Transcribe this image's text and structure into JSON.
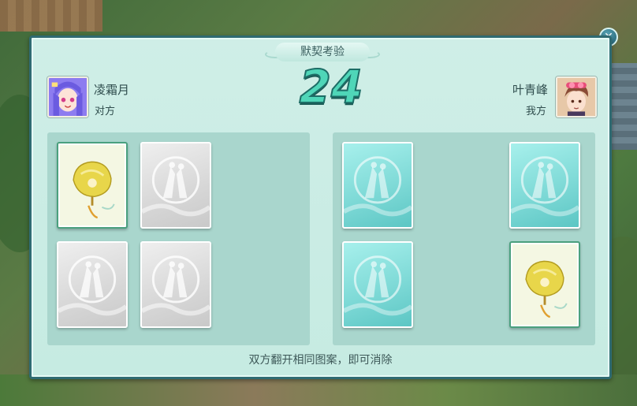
{
  "game": {
    "title": "默契考验",
    "timer": "24",
    "hint": "双方翻开相同图案，即可消除"
  },
  "players": {
    "left": {
      "name": "凌霜月",
      "role": "对方",
      "avatar_icon": "girl-avatar-icon"
    },
    "right": {
      "name": "叶青峰",
      "role": "我方",
      "avatar_icon": "boy-avatar-icon"
    }
  },
  "boards": {
    "left": {
      "cards": [
        {
          "state": "face-up",
          "icon": "fan-icon"
        },
        {
          "state": "face-down-grey",
          "icon": "couple-emblem-icon"
        },
        {
          "state": "face-down-grey",
          "icon": "couple-emblem-icon"
        },
        {
          "state": "face-down-grey",
          "icon": "couple-emblem-icon"
        }
      ]
    },
    "right": {
      "cards": [
        {
          "state": "face-down-teal",
          "icon": "couple-emblem-icon"
        },
        {
          "state": "face-down-teal",
          "icon": "couple-emblem-icon"
        },
        {
          "state": "face-down-teal",
          "icon": "couple-emblem-icon"
        },
        {
          "state": "face-up",
          "icon": "fan-icon"
        }
      ]
    }
  },
  "colors": {
    "panel": "#c6ebe2",
    "panel_border": "#2f6b72",
    "board": "#a9d6cd",
    "timer": "#4fd6b8",
    "card_teal": "#7fdad7",
    "card_grey": "#d7d7d7"
  }
}
